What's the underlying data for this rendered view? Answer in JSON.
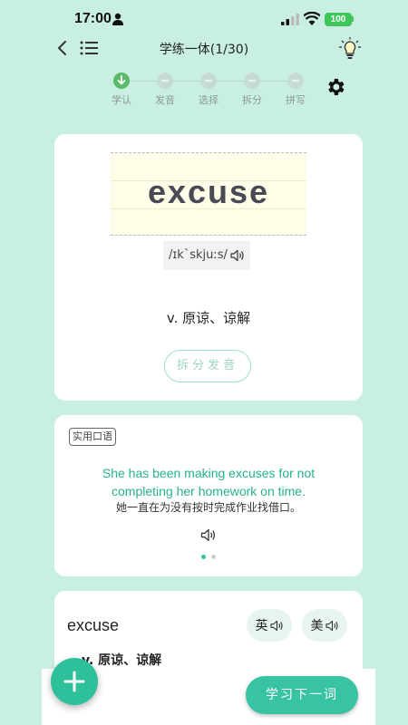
{
  "status_bar": {
    "time": "17:00",
    "battery": "100"
  },
  "header": {
    "title": "学练一体(1/30)"
  },
  "steps": [
    {
      "label": "学认",
      "active": true
    },
    {
      "label": "发音",
      "active": false
    },
    {
      "label": "选择",
      "active": false
    },
    {
      "label": "拆分",
      "active": false
    },
    {
      "label": "拼写",
      "active": false
    }
  ],
  "word_card": {
    "word": "excuse",
    "phonetic": "/ɪkˋskjuːs/",
    "meaning": "v. 原谅、谅解",
    "split_button": "拆分发音"
  },
  "sentence_card": {
    "tag": "实用口语",
    "sentence_en": "She has been making excuses for not completing her homework on time.",
    "sentence_cn": "她一直在为没有按时完成作业找借口。",
    "page_count": 2,
    "current_page": 1
  },
  "detail_card": {
    "word": "excuse",
    "uk_label": "英",
    "us_label": "美",
    "meaning": "v. 原谅、谅解"
  },
  "bottom": {
    "next_button": "学习下一词"
  },
  "colors": {
    "background": "#c9efe3",
    "accent": "#2cc09b",
    "sentence": "#27b28e",
    "active_step": "#5ab96b"
  },
  "icons": [
    "person-icon",
    "signal-icon",
    "wifi-icon",
    "back-icon",
    "list-icon",
    "bulb-icon",
    "gear-icon",
    "speaker-icon",
    "plus-icon"
  ]
}
